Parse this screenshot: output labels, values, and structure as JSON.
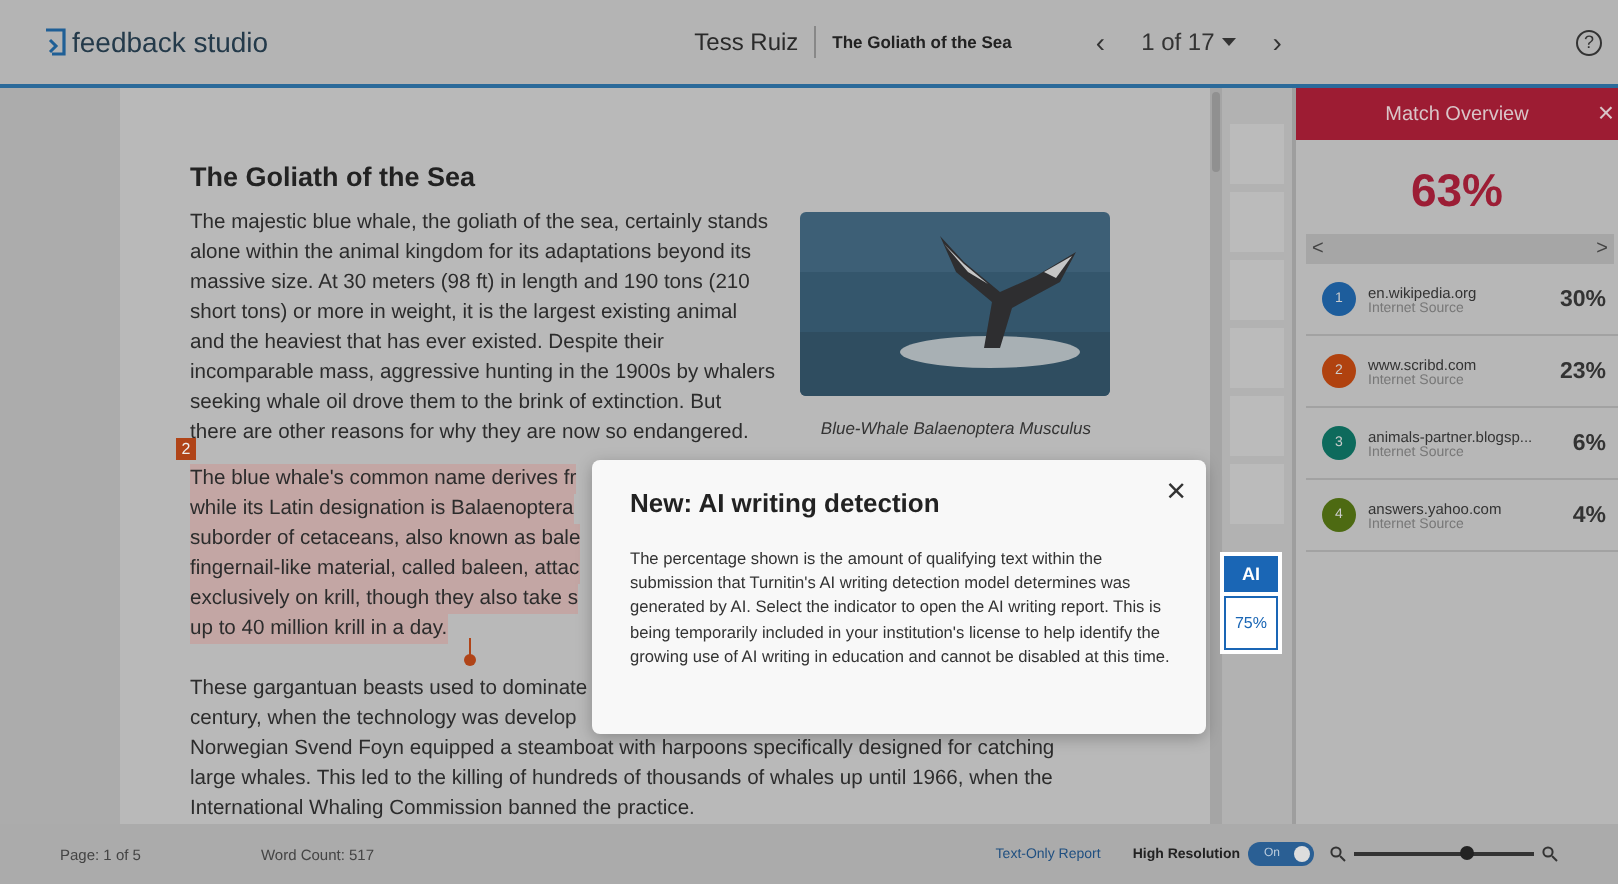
{
  "header": {
    "logo": "feedback studio",
    "student": "Tess Ruiz",
    "paper_title": "The Goliath of the Sea",
    "prev": "‹",
    "pager": "1 of 17",
    "next": "›",
    "help": "?"
  },
  "document": {
    "title": "The Goliath of the Sea",
    "paragraphs": [
      {
        "highlighted": false,
        "lines": [
          "The majestic blue whale, the goliath of the sea, certainly stands",
          "alone within the animal kingdom for its adaptations beyond its",
          "massive size. At 30 meters (98 ft) in length and 190 tons (210",
          "short tons) or more in weight, it is the largest existing animal",
          "and the heaviest that has ever existed. Despite their",
          "incomparable mass, aggressive hunting in the 1900s by whalers",
          "seeking whale oil drove them to the brink of extinction. But",
          "there are other reasons for why they are now so endangered."
        ]
      },
      {
        "highlighted": true,
        "marker": "2",
        "lines": [
          "The blue whale's common name derives fr",
          "while its Latin designation is Balaenoptera",
          "suborder of cetaceans, also known as bale",
          "fingernail-like material, called baleen, attac",
          "exclusively on krill, though they also take s",
          "up to 40 million krill in a day."
        ]
      },
      {
        "highlighted": false,
        "lines": [
          "These gargantuan beasts used to dominate",
          "century, when the technology was develop",
          "Norwegian Svend Foyn equipped a steamboat with harpoons specifically designed for catching",
          "large whales. This led to the killing of hundreds of thousands of whales up until 1966, when the",
          "International Whaling Commission banned the practice."
        ]
      }
    ],
    "figure": {
      "kind": "picture",
      "caption": "Blue-Whale Balaenoptera Musculus"
    }
  },
  "popup": {
    "title": "New: AI writing detection",
    "close": "×",
    "body": "The percentage shown is the amount of qualifying text within the submission that Turnitin's AI writing detection model determines was generated by AI. Select the indicator to open the AI writing report. This is being temporarily included in your institution's license to help identify the growing use of AI writing in education and cannot be disabled at this time."
  },
  "ai_indicator": {
    "label": "AI",
    "value": "75%"
  },
  "match_overview": {
    "title": "Match Overview",
    "close": "×",
    "total": "63%",
    "prev": "<",
    "next": ">",
    "sources": [
      {
        "number": "1",
        "name": "en.wikipedia.org",
        "type": "Internet Source",
        "percent": "30%",
        "color": "#1d5d9c"
      },
      {
        "number": "2",
        "name": "www.scribd.com",
        "type": "Internet Source",
        "percent": "23%",
        "color": "#b0420f"
      },
      {
        "number": "3",
        "name": "animals-partner.blogsp...",
        "type": "Internet Source",
        "percent": "6%",
        "color": "#0d6a5c"
      },
      {
        "number": "4",
        "name": "answers.yahoo.com",
        "type": "Internet Source",
        "percent": "4%",
        "color": "#4d6a12"
      }
    ]
  },
  "status_bar": {
    "page": "Page: 1 of 5",
    "word_count": "Word Count: 517",
    "text_only": "Text-Only Report",
    "high_res": {
      "label": "High Resolution",
      "on": true,
      "state": "On"
    },
    "zoom": {
      "level": 0.62
    }
  }
}
